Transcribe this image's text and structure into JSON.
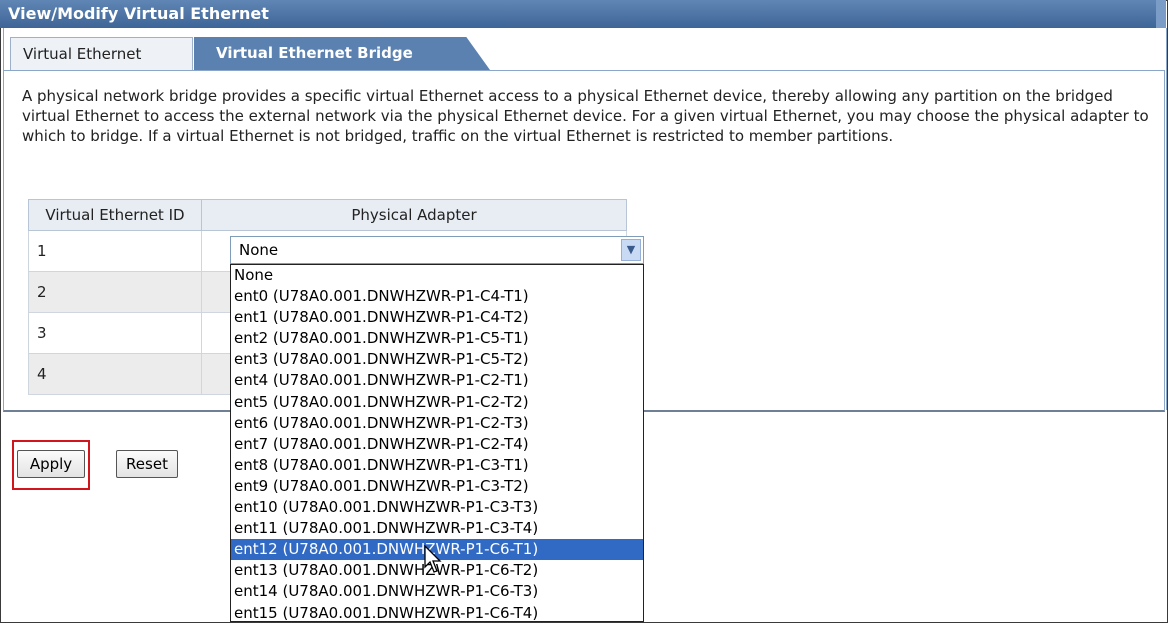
{
  "window": {
    "title": "View/Modify Virtual Ethernet"
  },
  "tabs": [
    {
      "label": "Virtual Ethernet"
    },
    {
      "label": "Virtual Ethernet Bridge"
    }
  ],
  "description": "A physical network bridge provides a specific virtual Ethernet access to a physical Ethernet device, thereby allowing any partition on the bridged virtual Ethernet to access the external network via the physical Ethernet device. For a given virtual Ethernet, you may choose the physical adapter to which to bridge. If a virtual Ethernet is not bridged, traffic on the virtual Ethernet is restricted to member partitions.",
  "table": {
    "headers": [
      "Virtual Ethernet ID",
      "Physical Adapter"
    ],
    "rows": [
      {
        "id": "1",
        "adapter": "None"
      },
      {
        "id": "2",
        "adapter": ""
      },
      {
        "id": "3",
        "adapter": ""
      },
      {
        "id": "4",
        "adapter": ""
      }
    ]
  },
  "dropdown": {
    "selected_value": "None",
    "highlighted": "ent12 (U78A0.001.DNWHZWR-P1-C6-T1)",
    "options": [
      "None",
      "ent0 (U78A0.001.DNWHZWR-P1-C4-T1)",
      "ent1 (U78A0.001.DNWHZWR-P1-C4-T2)",
      "ent2 (U78A0.001.DNWHZWR-P1-C5-T1)",
      "ent3 (U78A0.001.DNWHZWR-P1-C5-T2)",
      "ent4 (U78A0.001.DNWHZWR-P1-C2-T1)",
      "ent5 (U78A0.001.DNWHZWR-P1-C2-T2)",
      "ent6 (U78A0.001.DNWHZWR-P1-C2-T3)",
      "ent7 (U78A0.001.DNWHZWR-P1-C2-T4)",
      "ent8 (U78A0.001.DNWHZWR-P1-C3-T1)",
      "ent9 (U78A0.001.DNWHZWR-P1-C3-T2)",
      "ent10 (U78A0.001.DNWHZWR-P1-C3-T3)",
      "ent11 (U78A0.001.DNWHZWR-P1-C3-T4)",
      "ent12 (U78A0.001.DNWHZWR-P1-C6-T1)",
      "ent13 (U78A0.001.DNWHZWR-P1-C6-T2)",
      "ent14 (U78A0.001.DNWHZWR-P1-C6-T3)",
      "ent15 (U78A0.001.DNWHZWR-P1-C6-T4)"
    ]
  },
  "buttons": {
    "apply": "Apply",
    "reset": "Reset"
  },
  "colors": {
    "title_bar": "#4a71a3",
    "active_tab": "#5b81b1",
    "highlight_box": "#d0161c",
    "selected_option": "#316ac5"
  },
  "icons": {
    "select_arrow": "chevron-down-icon",
    "pointer": "mouse-cursor-icon"
  }
}
